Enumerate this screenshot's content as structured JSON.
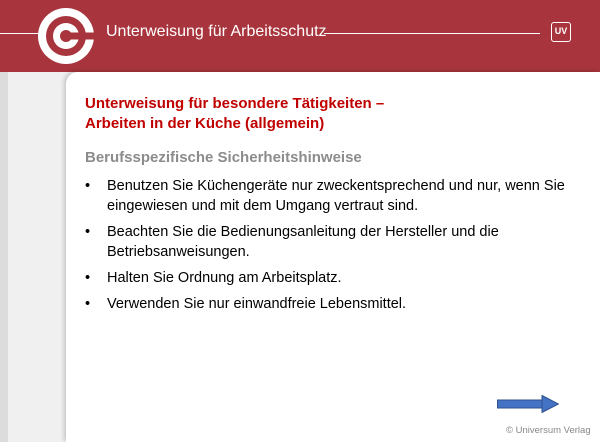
{
  "header": {
    "title": "Unterweisung für Arbeitsschutz",
    "badge": "UV"
  },
  "slide": {
    "heading_line1": "Unterweisung für besondere Tätigkeiten –",
    "heading_line2": "Arbeiten in der Küche (allgemein)",
    "subheading": "Berufsspezifische Sicherheitshinweise",
    "bullet_symbol": "•",
    "bullets": [
      "Benutzen Sie Küchengeräte nur zweckentsprechend und nur, wenn Sie eingewiesen und mit dem Umgang vertraut sind.",
      "Beachten Sie die Bedienungsanleitung der Hersteller und die Betriebsanweisungen.",
      "Halten Sie Ordnung am Arbeitsplatz.",
      "Verwenden Sie nur einwandfreie Lebensmittel."
    ]
  },
  "footer": {
    "copyright": "© Universum Verlag",
    "next_icon": "arrow-right-icon"
  },
  "colors": {
    "header_bg": "#a8353d",
    "heading": "#c00000",
    "subheading": "#8c8c8c",
    "arrow": "#4472c4"
  }
}
